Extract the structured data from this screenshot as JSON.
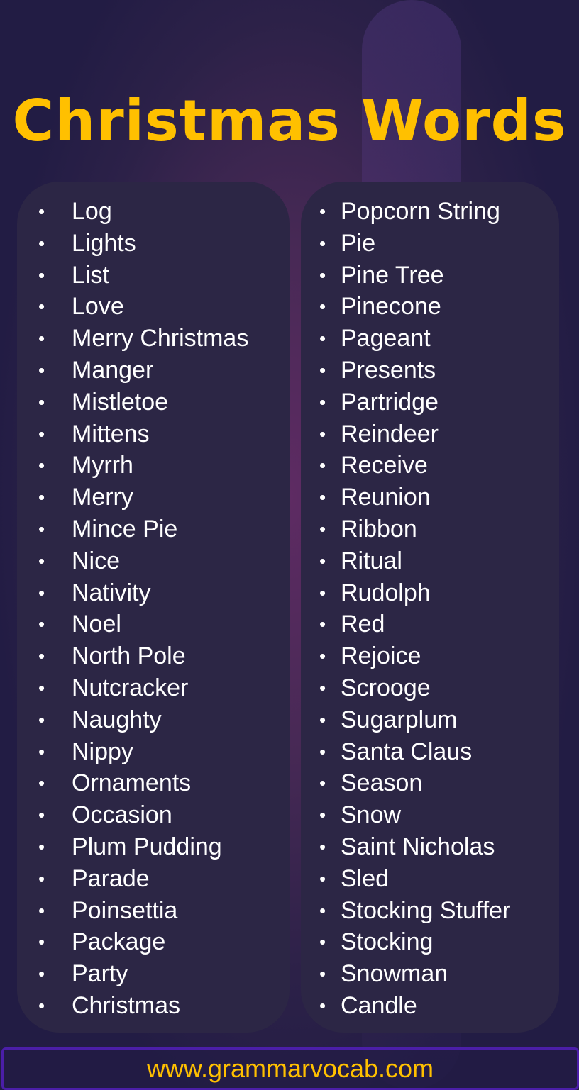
{
  "title": "Christmas Words",
  "columns": [
    {
      "words": [
        "Log",
        "Lights",
        "List",
        "Love",
        "Merry Christmas",
        "Manger",
        "Mistletoe",
        "Mittens",
        "Myrrh",
        "Merry",
        "Mince Pie",
        "Nice",
        "Nativity",
        "Noel",
        "North Pole",
        "Nutcracker",
        "Naughty",
        "Nippy",
        "Ornaments",
        "Occasion",
        "Plum Pudding",
        "Parade",
        "Poinsettia",
        "Package",
        "Party",
        "Christmas"
      ]
    },
    {
      "words": [
        "Popcorn String",
        "Pie",
        "Pine Tree",
        "Pinecone",
        "Pageant",
        "Presents",
        "Partridge",
        "Reindeer",
        "Receive",
        "Reunion",
        "Ribbon",
        "Ritual",
        "Rudolph",
        "Red",
        "Rejoice",
        "Scrooge",
        "Sugarplum",
        "Santa Claus",
        "Season",
        "Snow",
        "Saint Nicholas",
        "Sled",
        "Stocking Stuffer",
        "Stocking",
        "Snowman",
        "Candle"
      ]
    }
  ],
  "bullet": "•",
  "footer": {
    "url": "www.grammarvocab.com"
  },
  "colors": {
    "title": "#ffc000",
    "panel": "#2c2645",
    "text": "#ffffff",
    "footer_border": "#4b1ea8"
  }
}
